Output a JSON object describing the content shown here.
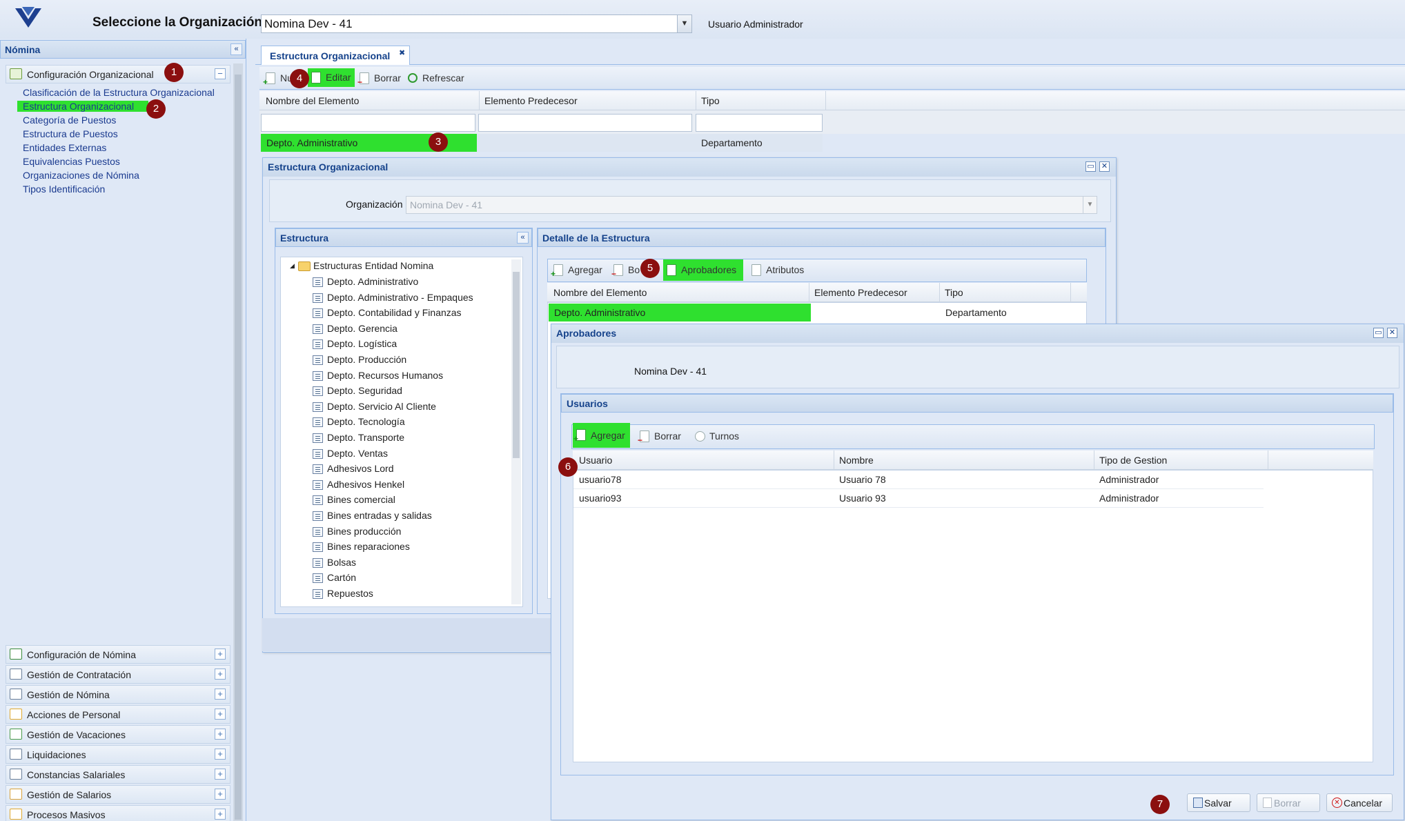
{
  "header": {
    "org_label": "Seleccione la Organización:",
    "org_value": "Nomina Dev - 41",
    "user": "Usuario Administrador"
  },
  "left": {
    "title": "Nómina",
    "section": "Configuración Organizacional",
    "links": [
      "Clasificación de la Estructura Organizacional",
      "Estructura Organizacional",
      "Categoría de Puestos",
      "Estructura de Puestos",
      "Entidades Externas",
      "Equivalencias Puestos",
      "Organizaciones de Nómina",
      "Tipos Identificación"
    ],
    "accordion": [
      "Configuración de Nómina",
      "Gestión de Contratación",
      "Gestión de Nómina",
      "Acciones de Personal",
      "Gestión de Vacaciones",
      "Liquidaciones",
      "Constancias Salariales",
      "Gestión de Salarios",
      "Procesos Masivos"
    ]
  },
  "main": {
    "tab": "Estructura Organizacional",
    "toolbar": {
      "new": "Nu",
      "edit": "Editar",
      "delete": "Borrar",
      "refresh": "Refrescar"
    },
    "columns": [
      "Nombre del Elemento",
      "Elemento Predecesor",
      "Tipo"
    ],
    "row": {
      "name": "Depto. Administrativo",
      "pred": "",
      "type": "Departamento"
    }
  },
  "dialog1": {
    "title": "Estructura Organizacional",
    "org_label": "Organización",
    "org_value": "Nomina Dev - 41",
    "tree_title": "Estructura",
    "tree_root": "Estructuras Entidad Nomina",
    "tree_items": [
      "Depto. Administrativo",
      "Depto. Administrativo - Empaques",
      "Depto. Contabilidad y Finanzas",
      "Depto. Gerencia",
      "Depto. Logística",
      "Depto. Producción",
      "Depto. Recursos Humanos",
      "Depto. Seguridad",
      "Depto. Servicio Al Cliente",
      "Depto. Tecnología",
      "Depto. Transporte",
      "Depto. Ventas",
      "Adhesivos Lord",
      "Adhesivos Henkel",
      "Bines comercial",
      "Bines entradas y salidas",
      "Bines producción",
      "Bines reparaciones",
      "Bolsas",
      "Cartón",
      "Repuestos"
    ],
    "detail_title": "Detalle de la Estructura",
    "toolbar": {
      "add": "Agregar",
      "delete": "Bo",
      "approvers": "Aprobadores",
      "attrs": "Atributos"
    },
    "columns": [
      "Nombre del Elemento",
      "Elemento Predecesor",
      "Tipo"
    ],
    "row": {
      "name": "Depto. Administrativo",
      "pred": "",
      "type": "Departamento"
    }
  },
  "dialog2": {
    "title": "Aprobadores",
    "org_value": "Nomina Dev - 41",
    "users_title": "Usuarios",
    "toolbar": {
      "add": "Agregar",
      "delete": "Borrar",
      "shifts": "Turnos"
    },
    "columns": [
      "Usuario",
      "Nombre",
      "Tipo de Gestion"
    ],
    "rows": [
      {
        "user": "usuario78",
        "name": "Usuario 78",
        "type": "Administrador"
      },
      {
        "user": "usuario93",
        "name": "Usuario 93",
        "type": "Administrador"
      }
    ],
    "buttons": {
      "save": "Salvar",
      "delete": "Borrar",
      "cancel": "Cancelar"
    }
  },
  "badges": [
    "1",
    "2",
    "3",
    "4",
    "5",
    "6",
    "7"
  ]
}
